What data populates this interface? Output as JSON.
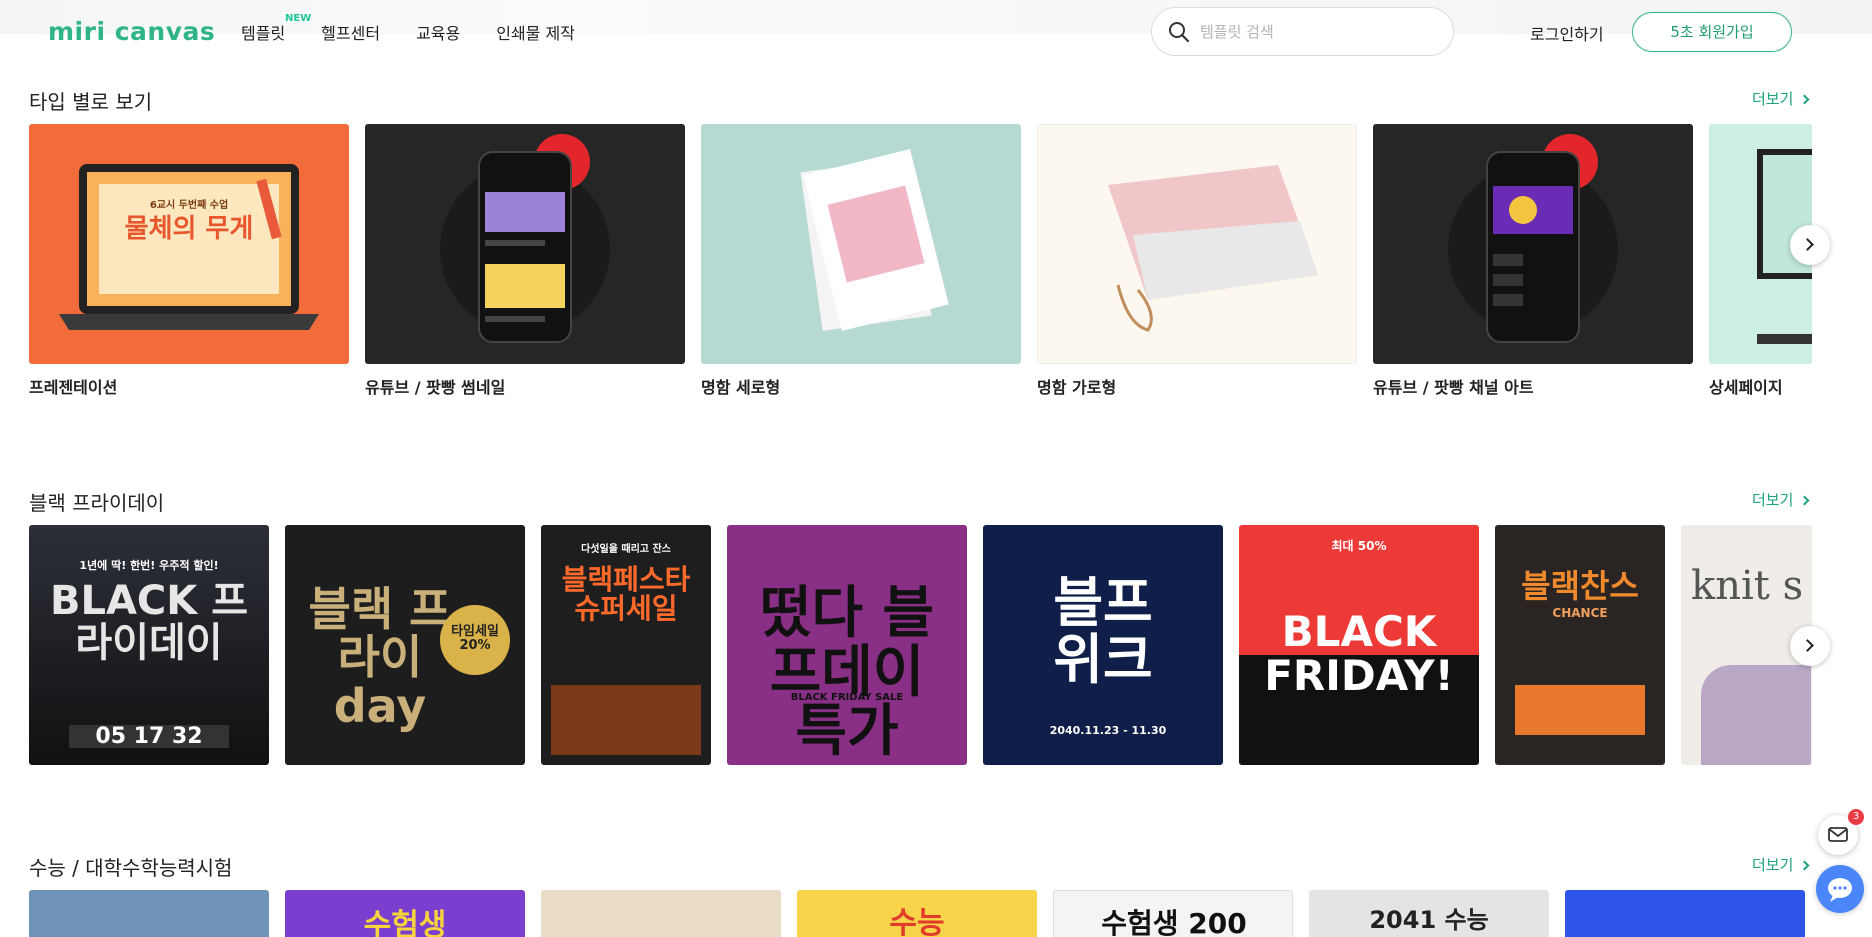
{
  "header": {
    "logo": "miri canvas",
    "nav": [
      {
        "label": "템플릿",
        "badge": "NEW"
      },
      {
        "label": "헬프센터"
      },
      {
        "label": "교육용"
      },
      {
        "label": "인쇄물 제작"
      }
    ],
    "search_placeholder": "템플릿 검색",
    "login_label": "로그인하기",
    "signup_label": "5초 회원가입"
  },
  "sections": [
    {
      "title": "타입 별로 보기",
      "more": "더보기",
      "cards": [
        {
          "label": "프레젠테이션",
          "thumb_text": "물체의 무게",
          "thumb_sub": "6교시 두번째 수업"
        },
        {
          "label": "유튜브 / 팟빵 썸네일",
          "thumb_text": ""
        },
        {
          "label": "명함 세로형",
          "thumb_text": ""
        },
        {
          "label": "명함 가로형",
          "thumb_text": ""
        },
        {
          "label": "유튜브 / 팟빵 채널 아트",
          "thumb_text": ""
        },
        {
          "label": "상세페이지",
          "thumb_text": ""
        }
      ]
    },
    {
      "title": "블랙 프라이데이",
      "more": "더보기",
      "cards": [
        {
          "thumb_text": "BLACK 프라이데이",
          "thumb_sub": "1년에 딱! 한번! 우주적 할인!",
          "timer": "05 17 32"
        },
        {
          "thumb_text": "블랙 프라이day",
          "thumb_sub": "타임세일 20%"
        },
        {
          "thumb_text": "블랙페스타 슈퍼세일",
          "thumb_sub": "다섯일을 때리고 잔스"
        },
        {
          "thumb_text": "떴다 블프데이특가",
          "thumb_sub": "BLACK FRIDAY SALE"
        },
        {
          "thumb_text": "블프 위크",
          "thumb_sub": "2040.11.23 - 11.30"
        },
        {
          "thumb_text": "BLACK FRIDAY!",
          "thumb_sub": "최대 50%"
        },
        {
          "thumb_text": "블랙찬스",
          "thumb_sub": "CHANCE"
        },
        {
          "thumb_text": "knit s",
          "thumb_sub": ""
        }
      ]
    },
    {
      "title": "수능 / 대학수학능력시험",
      "more": "더보기",
      "cards": [
        {
          "thumb_text": ""
        },
        {
          "thumb_text": "수험생"
        },
        {
          "thumb_text": ""
        },
        {
          "thumb_text": "수능"
        },
        {
          "thumb_text": "수험생 200"
        },
        {
          "thumb_text": "2041 수능"
        },
        {
          "thumb_text": ""
        }
      ]
    }
  ],
  "widgets": {
    "mail_badge": "3"
  },
  "colors": {
    "brand": "#2fb486",
    "link": "#1ba37a"
  }
}
